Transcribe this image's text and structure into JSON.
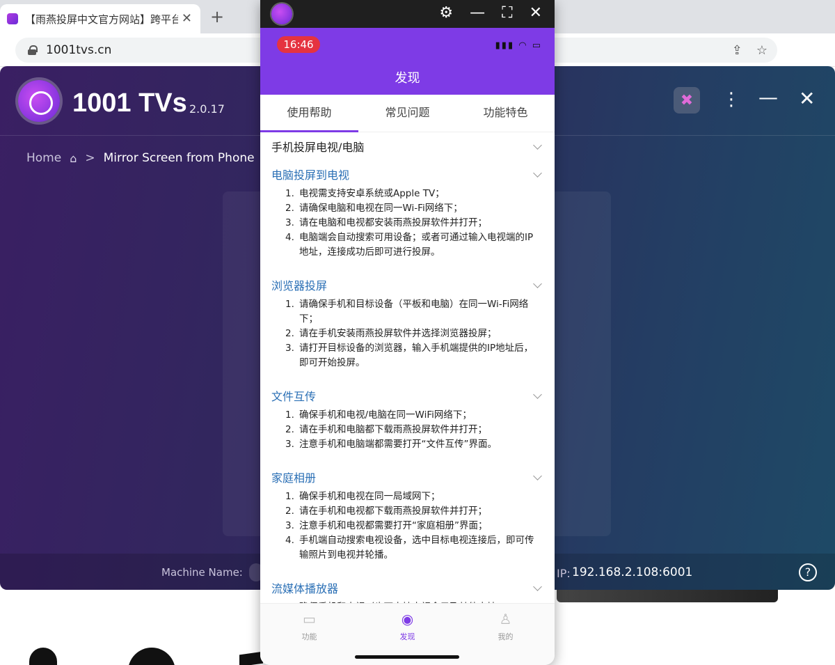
{
  "browser": {
    "tab_title": "【雨燕投屏中文官方网站】跨平台",
    "tab_close": "✕",
    "new_tab": "+",
    "url": "1001tvs.cn",
    "ext_label": "{≡}"
  },
  "app": {
    "title": "1001 TVs",
    "version": "2.0.17",
    "breadcrumb_home": "Home",
    "breadcrumb_sep": ">",
    "breadcrumb_current": "Mirror Screen from Phone",
    "machine_label": "Machine Name:",
    "ip_label": "IP:",
    "ip_value": "192.168.2.108:6001",
    "help": "?",
    "more": "⋮",
    "minimize": "—",
    "close": "✕"
  },
  "phone": {
    "window_icons": {
      "settings": "⚙",
      "minimize": "—",
      "fullscreen": "⛶",
      "close": "✕"
    },
    "status": {
      "time": "16:46"
    },
    "header_title": "发现",
    "tabs": [
      "使用帮助",
      "常见问题",
      "功能特色"
    ],
    "sections": [
      {
        "title": "手机投屏电视/电脑",
        "items": []
      },
      {
        "title": "电脑投屏到电视",
        "items": [
          "电视需支持安卓系统或Apple TV；",
          "请确保电脑和电视在同一Wi-Fi网络下；",
          "请在电脑和电视都安装雨燕投屏软件并打开；",
          "电脑端会自动搜索可用设备；或者可通过输入电视端的IP地址，连接成功后即可进行投屏。"
        ]
      },
      {
        "title": "浏览器投屏",
        "items": [
          "请确保手机和目标设备（平板和电脑）在同一Wi-Fi网络下；",
          "请在手机安装雨燕投屏软件并选择浏览器投屏；",
          "请打开目标设备的浏览器，输入手机端提供的IP地址后，即可开始投屏。"
        ]
      },
      {
        "title": "文件互传",
        "items": [
          "确保手机和电视/电脑在同一WiFi网络下；",
          "请在手机和电脑都下载雨燕投屏软件并打开；",
          "注意手机和电脑端都需要打开“文件互传”界面。"
        ]
      },
      {
        "title": "家庭相册",
        "items": [
          "确保手机和电视在同一局域网下；",
          "请在手机和电视都下载雨燕投屏软件并打开；",
          "注意手机和电视都需要打开“家庭相册”界面；",
          "手机端自动搜索电视设备，选中目标电视连接后，即可传输照片到电视并轮播。"
        ]
      },
      {
        "title": "流媒体播放器",
        "items": [
          "确保手机和电视（也可支持电视盒子及其他支持DLNA"
        ]
      }
    ],
    "bottom_nav": [
      {
        "label": "功能",
        "icon": "cast-icon"
      },
      {
        "label": "发现",
        "icon": "compass-icon"
      },
      {
        "label": "我的",
        "icon": "person-icon"
      }
    ],
    "accent_color": "#7e3be6"
  }
}
